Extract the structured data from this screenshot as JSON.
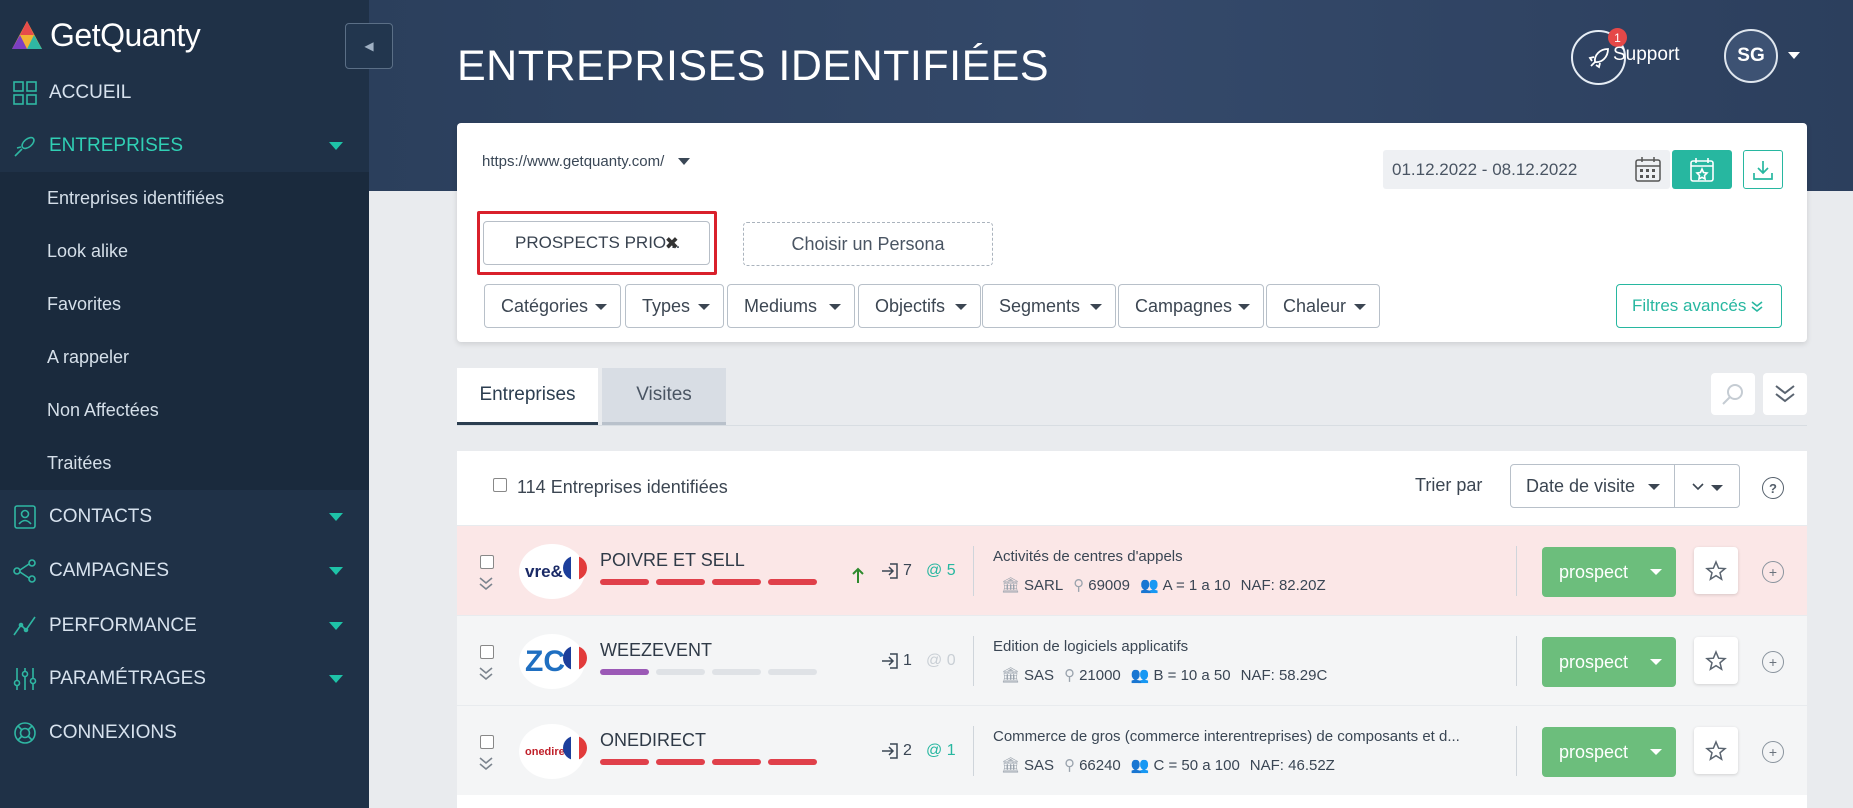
{
  "app": {
    "logo_text": "GetQuanty"
  },
  "sidebar": {
    "items": [
      {
        "label": "ACCUEIL",
        "icon": "dashboard-icon"
      },
      {
        "label": "ENTREPRISES",
        "icon": "rocket-icon"
      },
      {
        "label": "CONTACTS",
        "icon": "contact-card-icon"
      },
      {
        "label": "CAMPAGNES",
        "icon": "share-nodes-icon"
      },
      {
        "label": "PERFORMANCE",
        "icon": "chart-line-icon"
      },
      {
        "label": "PARAMÉTRAGES",
        "icon": "sliders-icon"
      },
      {
        "label": "CONNEXIONS",
        "icon": "lifebuoy-icon"
      }
    ],
    "submenu": [
      "Entreprises identifiées",
      "Look alike",
      "Favorites",
      "A rappeler",
      "Non Affectées",
      "Traitées"
    ]
  },
  "header": {
    "title": "ENTREPRISES IDENTIFIÉES",
    "notification_count": "1",
    "support_label": "Support",
    "avatar_initials": "SG"
  },
  "filters": {
    "site_url": "https://www.getquanty.com/",
    "date_range": "01.12.2022 - 08.12.2022",
    "persona_selected": "PROSPECTS PRIO...",
    "persona_choose": "Choisir un Persona",
    "buttons": [
      "Catégories",
      "Types",
      "Mediums",
      "Objectifs",
      "Segments",
      "Campagnes",
      "Chaleur"
    ],
    "advanced": "Filtres avancés"
  },
  "tabs": {
    "entreprises": "Entreprises",
    "visites": "Visites"
  },
  "list": {
    "count_label": "114 Entreprises identifiées",
    "sort_label": "Trier par",
    "sort_value": "Date de visite",
    "help": "?",
    "rows": [
      {
        "name": "POIVRE ET SELL",
        "logo_text": "vre&",
        "visits": "7",
        "emails": "@ 5",
        "activity": "Activités de centres d'appels",
        "legal": "SARL",
        "postal": "69009",
        "size": "A = 1 a 10",
        "naf": "NAF: 82.20Z",
        "status": "prospect",
        "heat_level": 4,
        "heat_color": "#e0404a",
        "highlight": true
      },
      {
        "name": "WEEZEVENT",
        "logo_text": "ZC",
        "visits": "1",
        "emails": "@ 0",
        "activity": "Edition de logiciels applicatifs",
        "legal": "SAS",
        "postal": "21000",
        "size": "B = 10 a 50",
        "naf": "NAF: 58.29C",
        "status": "prospect",
        "heat_level": 1,
        "heat_color": "#9b59b6",
        "highlight": false
      },
      {
        "name": "ONEDIRECT",
        "logo_text": "onedire",
        "visits": "2",
        "emails": "@ 1",
        "activity": "Commerce de gros (commerce interentreprises) de composants et d...",
        "legal": "SAS",
        "postal": "66240",
        "size": "C = 50 a 100",
        "naf": "NAF: 46.52Z",
        "status": "prospect",
        "heat_level": 4,
        "heat_color": "#e0404a",
        "highlight": false
      }
    ]
  },
  "colors": {
    "accent": "#27b7a0",
    "sidebar": "#1f3147",
    "status_green": "#6cbe7c",
    "hot_row": "#fbe7e7"
  }
}
